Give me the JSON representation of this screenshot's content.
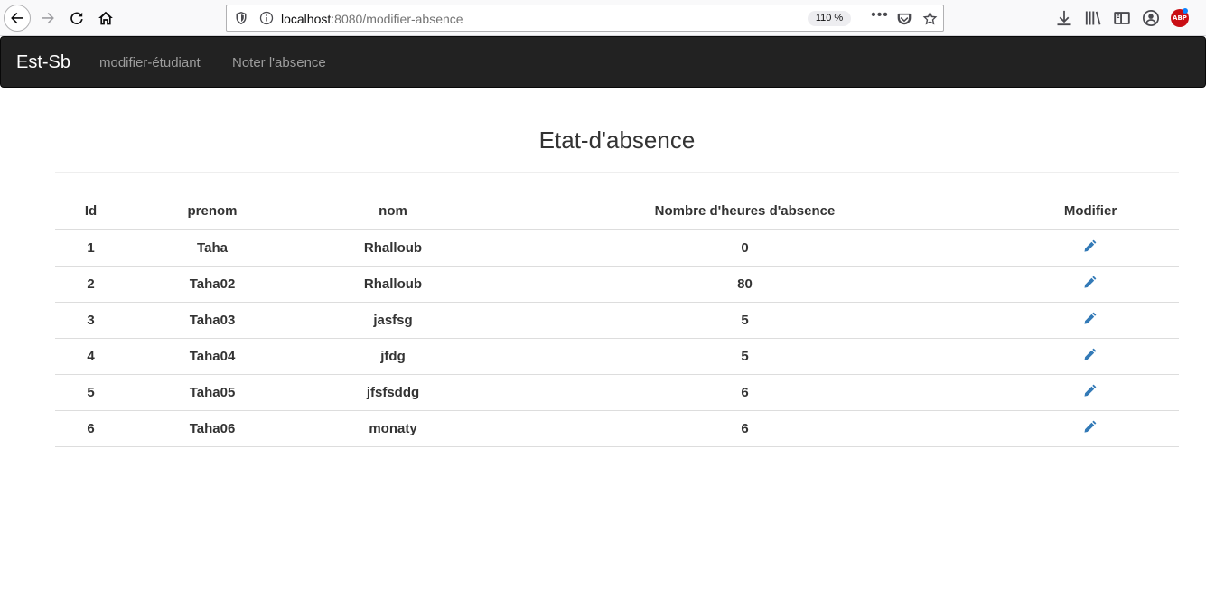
{
  "browser": {
    "url_host": "localhost",
    "url_path": ":8080/modifier-absence",
    "zoom": "110 %",
    "more_label": "•••"
  },
  "navbar": {
    "brand": "Est-Sb",
    "links": [
      "modifier-étudiant",
      "Noter l'absence"
    ]
  },
  "page": {
    "title": "Etat-d'absence"
  },
  "table": {
    "headers": [
      "Id",
      "prenom",
      "nom",
      "Nombre d'heures d'absence",
      "Modifier"
    ],
    "rows": [
      {
        "id": "1",
        "prenom": "Taha",
        "nom": "Rhalloub",
        "heures": "0",
        "action_icon": "pencil-icon"
      },
      {
        "id": "2",
        "prenom": "Taha02",
        "nom": "Rhalloub",
        "heures": "80",
        "action_icon": "pencil-icon"
      },
      {
        "id": "3",
        "prenom": "Taha03",
        "nom": "jasfsg",
        "heures": "5",
        "action_icon": "pencil-icon"
      },
      {
        "id": "4",
        "prenom": "Taha04",
        "nom": "jfdg",
        "heures": "5",
        "action_icon": "pencil-icon"
      },
      {
        "id": "5",
        "prenom": "Taha05",
        "nom": "jfsfsddg",
        "heures": "6",
        "action_icon": "pencil-icon"
      },
      {
        "id": "6",
        "prenom": "Taha06",
        "nom": "monaty",
        "heures": "6",
        "action_icon": "pencil-icon"
      }
    ]
  },
  "colors": {
    "navbar_bg": "#222222",
    "nav_link": "#9d9d9d",
    "edit_icon": "#337ab7",
    "abp_badge": "#c90e14"
  },
  "icons": {
    "browser": [
      "back-arrow-icon",
      "forward-arrow-icon",
      "reload-icon",
      "home-icon",
      "shield-icon",
      "info-icon",
      "pocket-icon",
      "star-icon",
      "download-icon",
      "library-icon",
      "sidebar-icon",
      "account-icon",
      "adblock-plus-icon"
    ],
    "abp_label": "ABP"
  }
}
